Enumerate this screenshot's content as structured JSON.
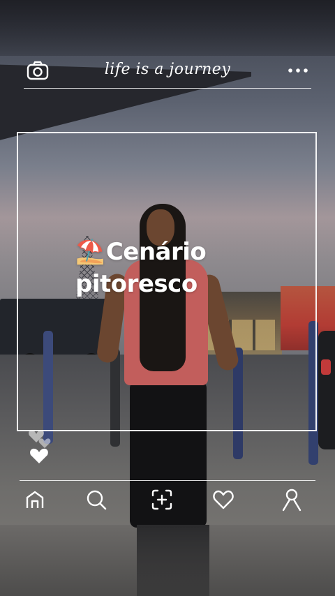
{
  "header": {
    "title": "life is a journey",
    "camera_icon": "camera-icon",
    "more_icon": "more-horizontal-icon"
  },
  "caption": {
    "emoji": "⛱️",
    "text": "Cenário pitoresco"
  },
  "reactions": {
    "icon": "heart-icon"
  },
  "nav": {
    "items": [
      {
        "icon": "home-icon"
      },
      {
        "icon": "search-icon"
      },
      {
        "icon": "add-post-icon"
      },
      {
        "icon": "heart-icon"
      },
      {
        "icon": "profile-icon"
      }
    ]
  },
  "colors": {
    "overlay": "#ffffff",
    "shirt": "#c25e5c"
  }
}
